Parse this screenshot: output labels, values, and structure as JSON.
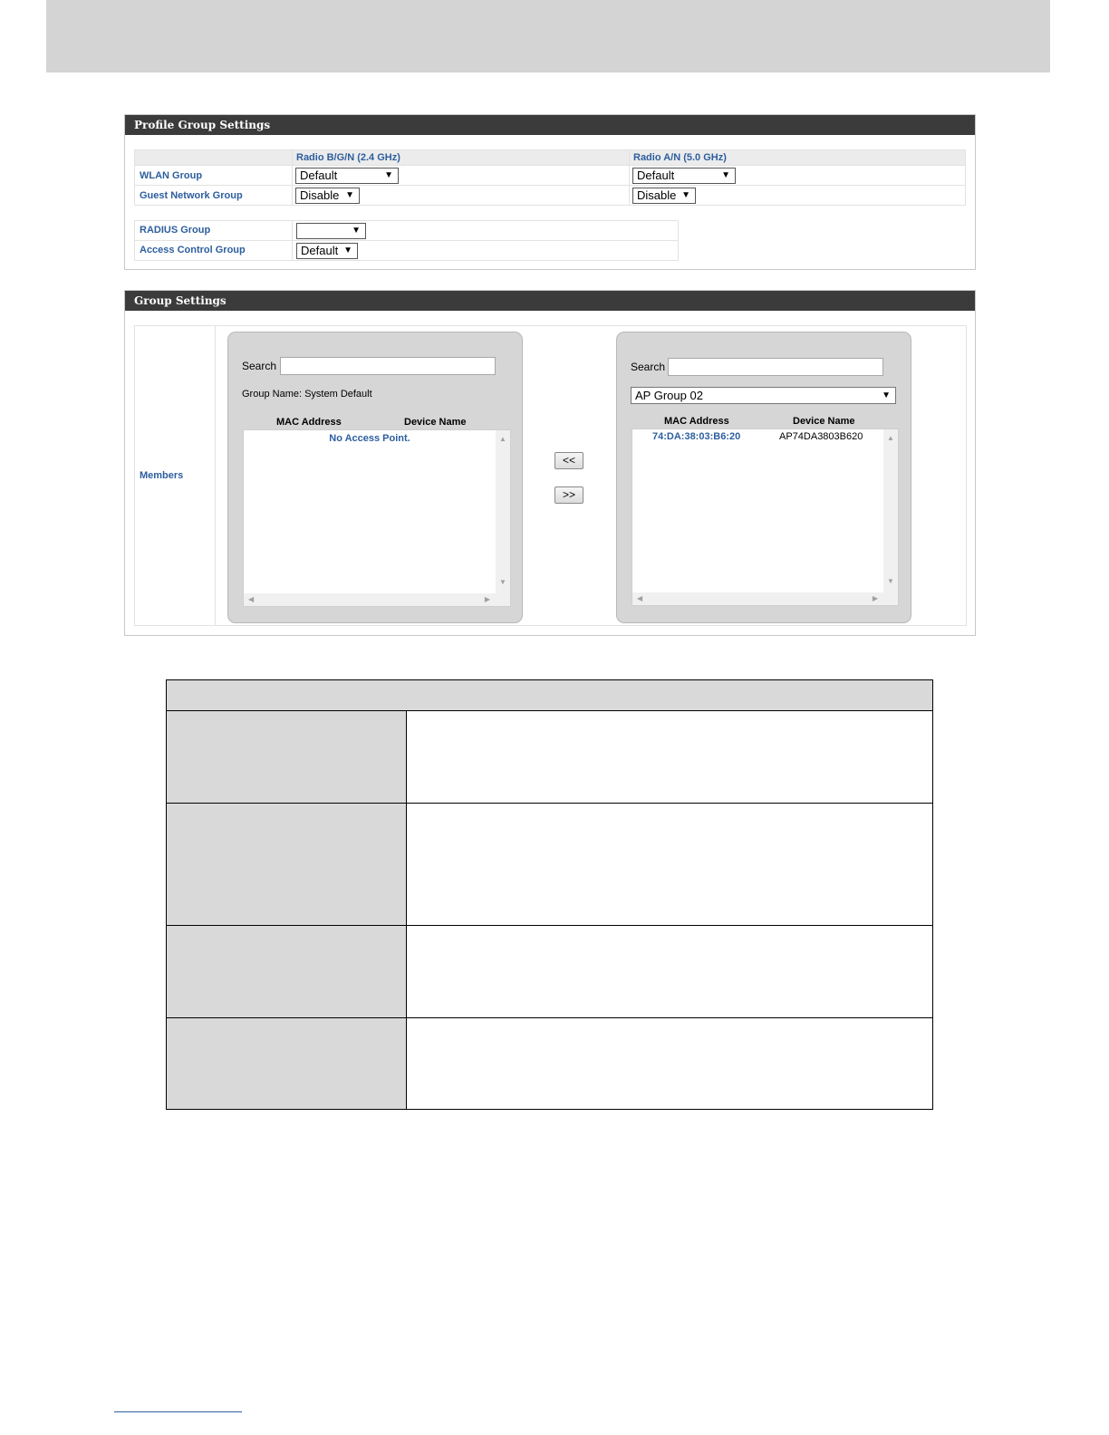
{
  "profile_group_settings": {
    "title": "Profile Group Settings",
    "col_bgn": "Radio B/G/N (2.4 GHz)",
    "col_an": "Radio A/N (5.0 GHz)",
    "rows": {
      "wlan_group": {
        "label": "WLAN Group",
        "bgn_value": "Default",
        "an_value": "Default"
      },
      "guest_network_group": {
        "label": "Guest Network Group",
        "bgn_value": "Disable",
        "an_value": "Disable"
      }
    },
    "radius_group": {
      "label": "RADIUS Group",
      "value": ""
    },
    "access_control_group": {
      "label": "Access Control Group",
      "value": "Default"
    }
  },
  "group_settings": {
    "title": "Group Settings",
    "members_label": "Members",
    "left_box": {
      "search_label": "Search",
      "search_value": "",
      "group_name_text": "Group Name: System Default",
      "col_mac": "MAC Address",
      "col_device": "Device Name",
      "empty_text": "No Access Point."
    },
    "right_box": {
      "search_label": "Search",
      "search_value": "",
      "group_select": "AP Group 02",
      "col_mac": "MAC Address",
      "col_device": "Device Name",
      "rows": [
        {
          "mac": "74:DA:38:03:B6:20",
          "device": "AP74DA3803B620"
        }
      ]
    },
    "move_left_label": "<<",
    "move_right_label": ">>"
  },
  "icons": {
    "dropdown_arrow": "▼",
    "scroll_up": "▲",
    "scroll_down": "▼",
    "scroll_left": "◀",
    "scroll_right": "▶"
  },
  "colors": {
    "header_bar": "#3b3b3b",
    "label_blue": "#2d5e9e",
    "box_gray": "#d6d6d6",
    "table_gray": "#d9d9d9"
  }
}
